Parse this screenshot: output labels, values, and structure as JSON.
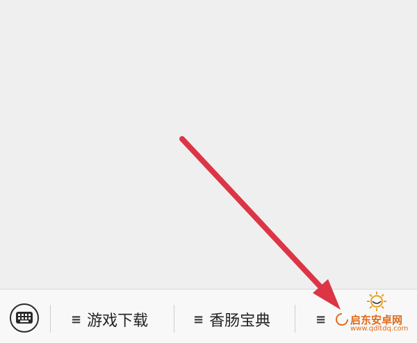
{
  "bottom_menu": {
    "items": [
      {
        "label": "游戏下载"
      },
      {
        "label": "香肠宝典"
      },
      {
        "label": ""
      }
    ],
    "hamburger_glyph": "≡"
  },
  "watermark": {
    "name": "启东安卓网",
    "url": "www.qdltdq.com"
  },
  "colors": {
    "arrow": "#dc3545",
    "watermark": "#e06a1a"
  }
}
